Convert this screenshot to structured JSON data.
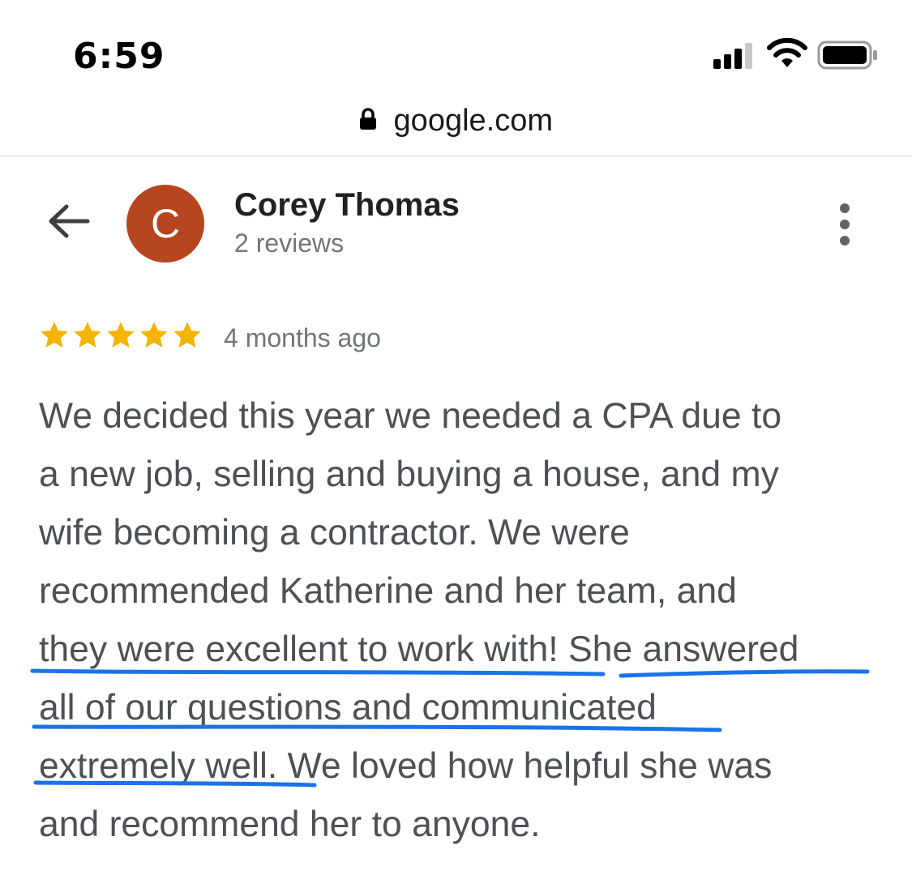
{
  "status_bar": {
    "time": "6:59",
    "signal_icon": "cellular-signal-icon",
    "wifi_icon": "wifi-icon",
    "battery_icon": "battery-icon"
  },
  "browser": {
    "url": "google.com",
    "lock_icon": "lock-icon"
  },
  "reviewer": {
    "avatar_letter": "C",
    "avatar_color": "#b5461f",
    "name": "Corey Thomas",
    "review_count": "2 reviews"
  },
  "review": {
    "stars": 5,
    "star_color": "#f4b400",
    "time_ago": "4 months ago",
    "lines": [
      "We decided this year we needed a CPA due to",
      "a new job, selling and buying a house, and my",
      "wife becoming a contractor. We were",
      "recommended Katherine and her team, and",
      "they were excellent to work with! She answered",
      "all of our questions and communicated",
      "extremely well. We loved how helpful she was",
      "and recommend her to anyone."
    ]
  },
  "annotation": {
    "underline_color": "#1a73e8"
  }
}
